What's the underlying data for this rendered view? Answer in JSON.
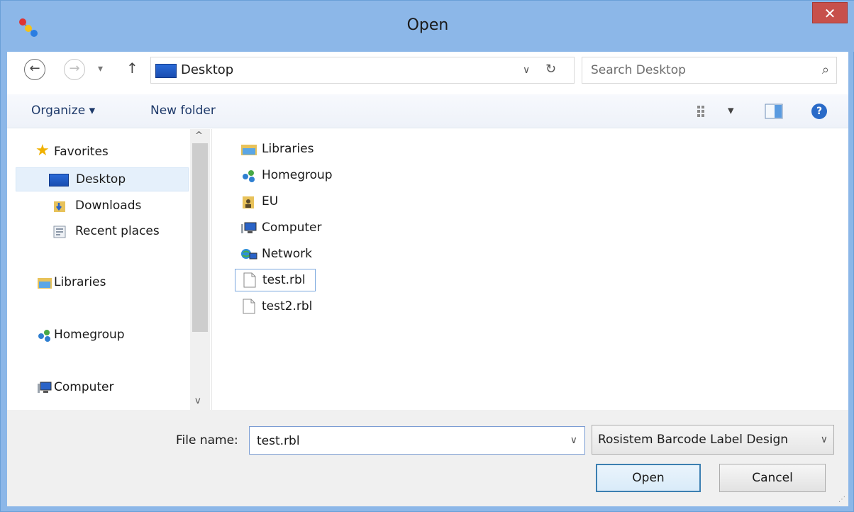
{
  "window": {
    "title": "Open",
    "close_glyph": "✕",
    "app_icon": "molecule-app-icon"
  },
  "address": {
    "back_glyph": "←",
    "forward_glyph": "→",
    "recent_glyph": "▾",
    "up_glyph": "↑",
    "location": "Desktop",
    "location_icon": "desktop-icon",
    "dropdown_glyph": "∨",
    "refresh_glyph": "↻"
  },
  "search": {
    "placeholder": "Search Desktop",
    "icon_glyph": "⌕"
  },
  "toolbar": {
    "organize_label": "Organize ▾",
    "new_folder_label": "New folder",
    "views_icon": "view-options-icon",
    "views_dropdown_glyph": "▾",
    "preview_icon": "preview-pane-icon",
    "help_glyph": "?"
  },
  "navpane": {
    "items": [
      {
        "label": "Favorites",
        "icon": "star-icon"
      },
      {
        "label": "Desktop",
        "icon": "desktop-icon",
        "selected": true
      },
      {
        "label": "Downloads",
        "icon": "downloads-icon"
      },
      {
        "label": "Recent places",
        "icon": "recent-places-icon"
      },
      {
        "label": "Libraries",
        "icon": "libraries-icon"
      },
      {
        "label": "Homegroup",
        "icon": "homegroup-icon"
      },
      {
        "label": "Computer",
        "icon": "computer-icon"
      }
    ],
    "scroll_up_glyph": "^",
    "scroll_down_glyph": "v"
  },
  "files": [
    {
      "label": "Libraries",
      "icon": "libraries-icon"
    },
    {
      "label": "Homegroup",
      "icon": "homegroup-icon"
    },
    {
      "label": "EU",
      "icon": "user-folder-icon"
    },
    {
      "label": "Computer",
      "icon": "computer-icon"
    },
    {
      "label": "Network",
      "icon": "network-icon"
    },
    {
      "label": "test.rbl",
      "icon": "file-icon",
      "focused": true
    },
    {
      "label": "test2.rbl",
      "icon": "file-icon"
    }
  ],
  "bottom": {
    "file_name_label": "File name:",
    "file_name_value": "test.rbl",
    "file_name_dropdown_glyph": "∨",
    "file_type": "Rosistem Barcode Label Design",
    "file_type_dropdown_glyph": "∨",
    "open_label": "Open",
    "cancel_label": "Cancel",
    "grip_glyph": "⋰"
  },
  "colors": {
    "title_bar": "#8cb7e8",
    "close_button": "#c7504b",
    "selection": "#e5f0fb",
    "accent": "#3c7fb1"
  }
}
